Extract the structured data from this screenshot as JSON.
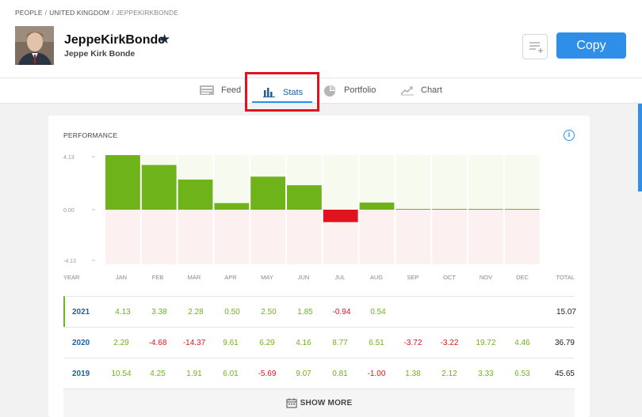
{
  "breadcrumb": {
    "people": "PEOPLE",
    "country": "UNITED KINGDOM",
    "user": "JEPPEKIRKBONDE"
  },
  "profile": {
    "username": "JeppeKirkBonde",
    "full_name": "Jeppe Kirk Bonde"
  },
  "actions": {
    "copy_label": "Copy"
  },
  "tabs": [
    {
      "label": "Feed",
      "icon": "feed-icon"
    },
    {
      "label": "Stats",
      "icon": "bar-chart-icon"
    },
    {
      "label": "Portfolio",
      "icon": "pie-chart-icon"
    },
    {
      "label": "Chart",
      "icon": "line-chart-icon"
    }
  ],
  "performance": {
    "title": "PERFORMANCE",
    "show_more": "SHOW MORE",
    "headers": [
      "YEAR",
      "JAN",
      "FEB",
      "MAR",
      "APR",
      "MAY",
      "JUN",
      "JUL",
      "AUG",
      "SEP",
      "OCT",
      "NOV",
      "DEC",
      "TOTAL"
    ],
    "rows": [
      {
        "year": "2021",
        "months": [
          "4.13",
          "3.38",
          "2.28",
          "0.50",
          "2.50",
          "1.85",
          "-0.94",
          "0.54",
          "",
          "",
          "",
          ""
        ],
        "total": "15.07"
      },
      {
        "year": "2020",
        "months": [
          "2.29",
          "-4.68",
          "-14.37",
          "9.61",
          "6.29",
          "4.16",
          "8.77",
          "6.51",
          "-3.72",
          "-3.22",
          "19.72",
          "4.46"
        ],
        "total": "36.79"
      },
      {
        "year": "2019",
        "months": [
          "10.54",
          "4.25",
          "1.91",
          "6.01",
          "-5.69",
          "9.07",
          "0.81",
          "-1.00",
          "1.38",
          "2.12",
          "3.33",
          "6.53"
        ],
        "total": "45.65"
      }
    ]
  },
  "chart_data": {
    "type": "bar",
    "categories": [
      "JAN",
      "FEB",
      "MAR",
      "APR",
      "MAY",
      "JUN",
      "JUL",
      "AUG",
      "SEP",
      "OCT",
      "NOV",
      "DEC"
    ],
    "values": [
      4.13,
      3.38,
      2.28,
      0.5,
      2.5,
      1.85,
      -0.94,
      0.54,
      0,
      0,
      0,
      0
    ],
    "ylim": [
      -4.13,
      4.13
    ],
    "yticks": [
      "4.13",
      "0.00",
      "-4.13"
    ],
    "colors": {
      "positive": "#6fb31a",
      "negative": "#e0141e",
      "bg_positive": "#f6faef",
      "bg_negative": "#fdf0f0"
    },
    "grid": false
  }
}
